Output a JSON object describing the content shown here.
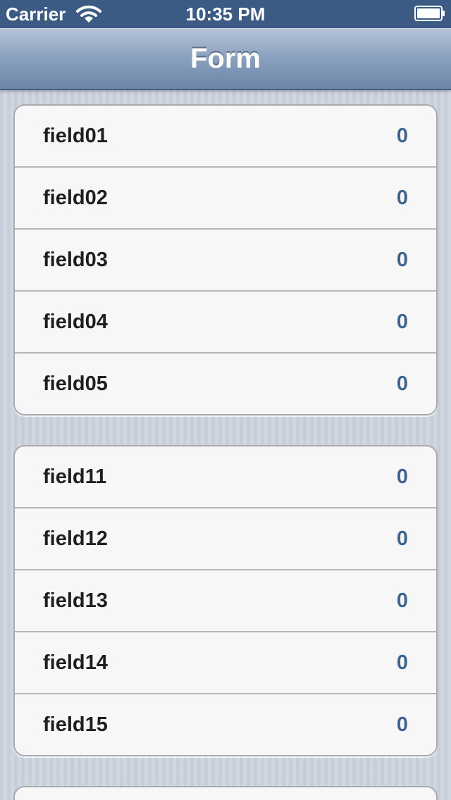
{
  "status_bar": {
    "carrier": "Carrier",
    "time": "10:35 PM",
    "wifi_icon": "wifi-icon",
    "battery_icon": "battery-icon"
  },
  "nav": {
    "title": "Form"
  },
  "sections": [
    {
      "rows": [
        {
          "label": "field01",
          "value": "0"
        },
        {
          "label": "field02",
          "value": "0"
        },
        {
          "label": "field03",
          "value": "0"
        },
        {
          "label": "field04",
          "value": "0"
        },
        {
          "label": "field05",
          "value": "0"
        }
      ]
    },
    {
      "rows": [
        {
          "label": "field11",
          "value": "0"
        },
        {
          "label": "field12",
          "value": "0"
        },
        {
          "label": "field13",
          "value": "0"
        },
        {
          "label": "field14",
          "value": "0"
        },
        {
          "label": "field15",
          "value": "0"
        }
      ]
    }
  ],
  "colors": {
    "nav_bar": "#6c86a8",
    "value_text": "#3c6592",
    "label_text": "#1f1f1f",
    "cell_background": "#f7f7f7"
  }
}
